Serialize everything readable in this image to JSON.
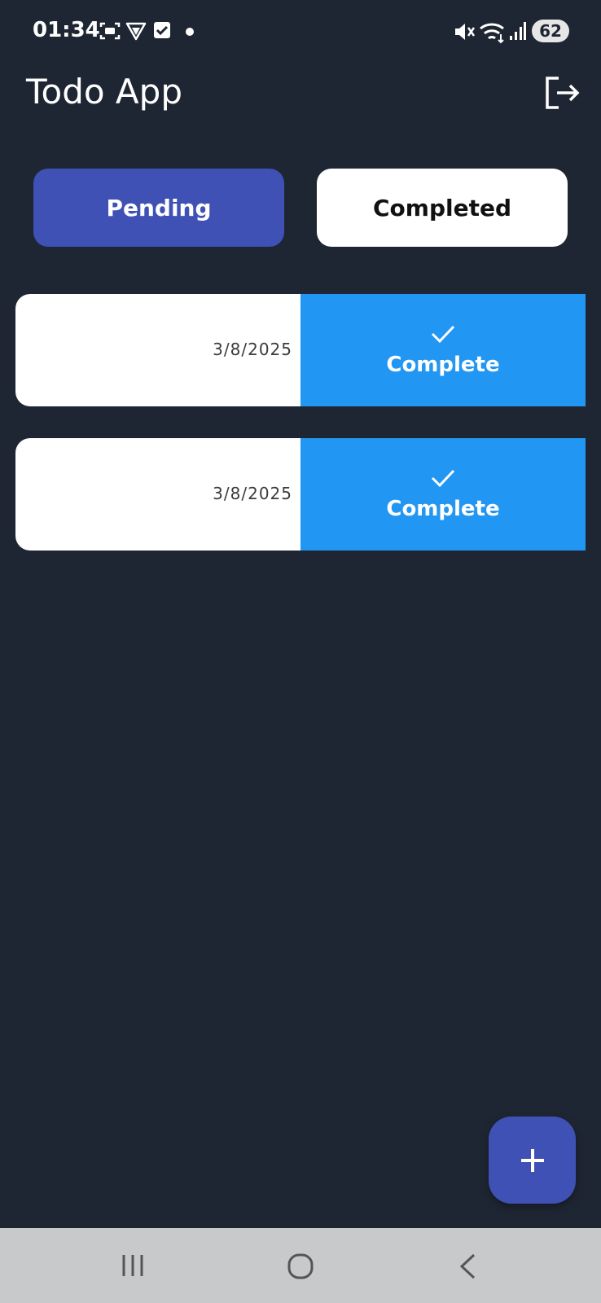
{
  "status_bar": {
    "time": "01:34",
    "battery": "62",
    "icons": [
      "screenshot-icon",
      "vpn-shield-icon",
      "checkbox-notification-icon",
      "notification-dot",
      "mute-icon",
      "wifi-icon",
      "signal-icon",
      "battery-icon"
    ]
  },
  "app_bar": {
    "title": "Todo App",
    "logout_icon": "logout-icon"
  },
  "tabs": [
    {
      "label": "Pending",
      "selected": true
    },
    {
      "label": "Completed",
      "selected": false
    }
  ],
  "todos": [
    {
      "date": "3/8/2025",
      "action_label": "Complete",
      "action_icon": "check-icon"
    },
    {
      "date": "3/8/2025",
      "action_label": "Complete",
      "action_icon": "check-icon"
    }
  ],
  "fab": {
    "icon": "plus-icon"
  },
  "nav_bar": {
    "icons": [
      "recents-icon",
      "home-icon",
      "back-icon"
    ]
  },
  "colors": {
    "background": "#1f2633",
    "primary": "#3f51b5",
    "action_blue": "#2196f3",
    "card": "#ffffff",
    "nav_bar": "#c8c9cb"
  }
}
